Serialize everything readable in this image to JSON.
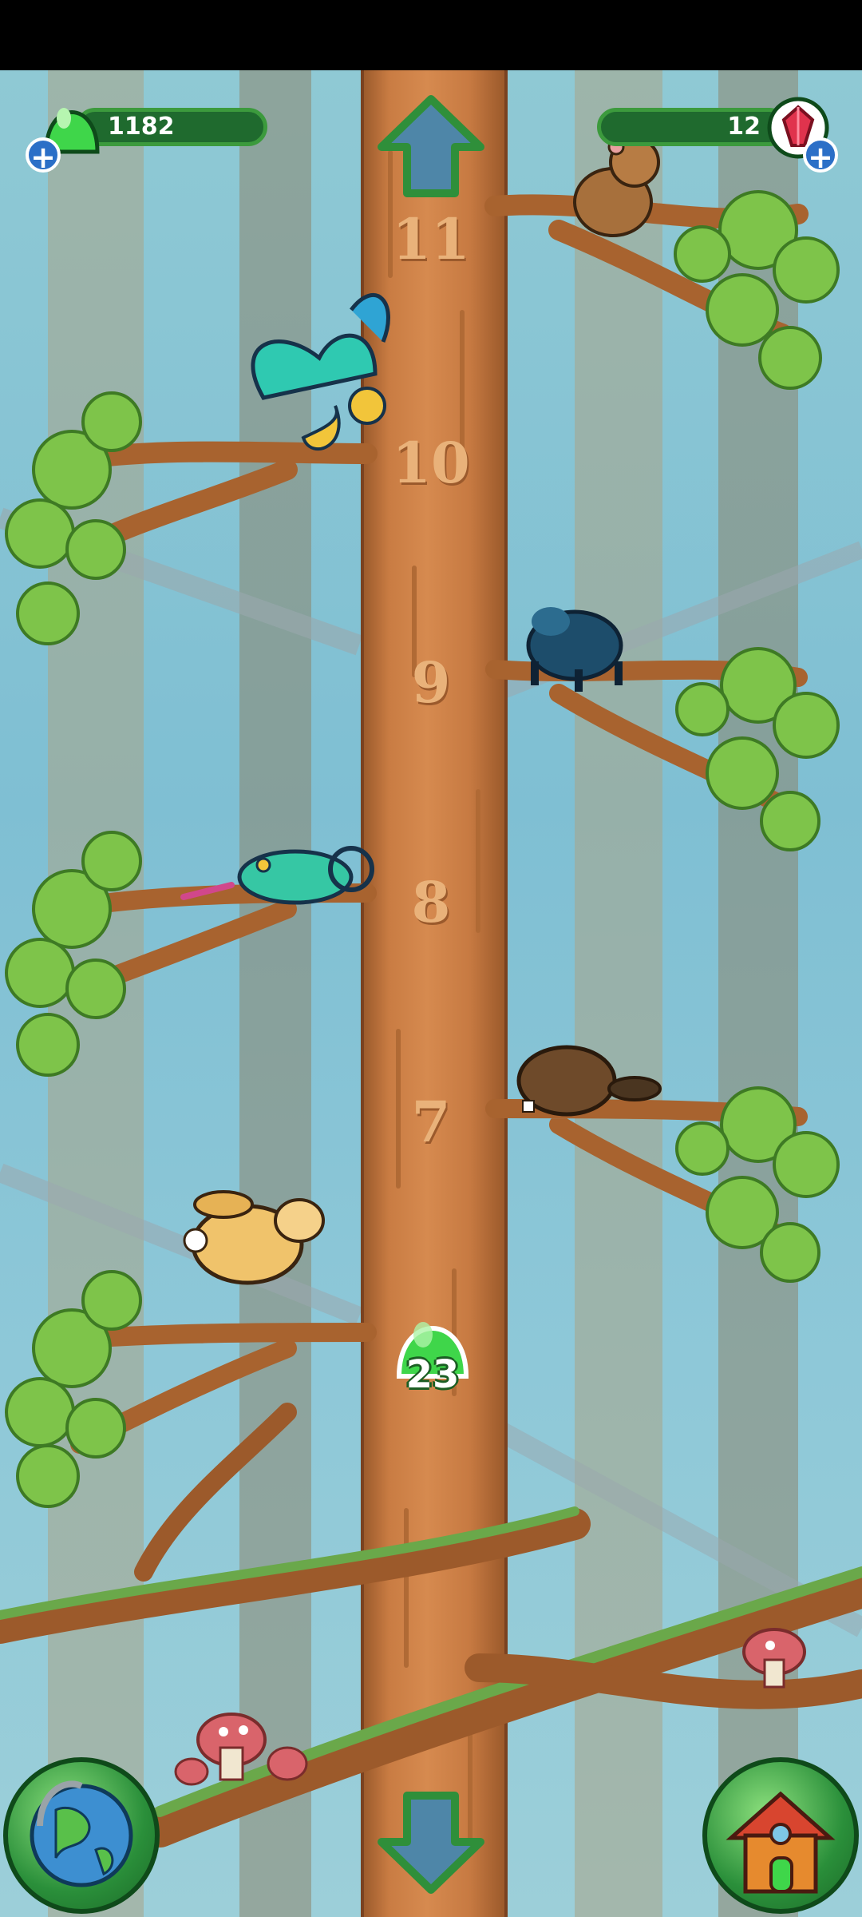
{
  "hud": {
    "slime_count": "1182",
    "gem_count": "12"
  },
  "tree": {
    "levels": [
      "11",
      "10",
      "9",
      "8",
      "7"
    ]
  },
  "badge": {
    "count": "23"
  },
  "colors": {
    "trunk": "#c97c43",
    "leaf": "#7ec44a",
    "hud_green": "#1f6a2e",
    "slime": "#3fd64a",
    "gem": "#e0334d",
    "plus_blue": "#2b6fc7"
  },
  "icons": {
    "slime": "green-slime-icon",
    "gem": "red-gem-icon",
    "plus": "plus-icon",
    "up": "arrow-up-icon",
    "down": "arrow-down-icon",
    "globe": "globe-icon",
    "house": "house-icon"
  }
}
